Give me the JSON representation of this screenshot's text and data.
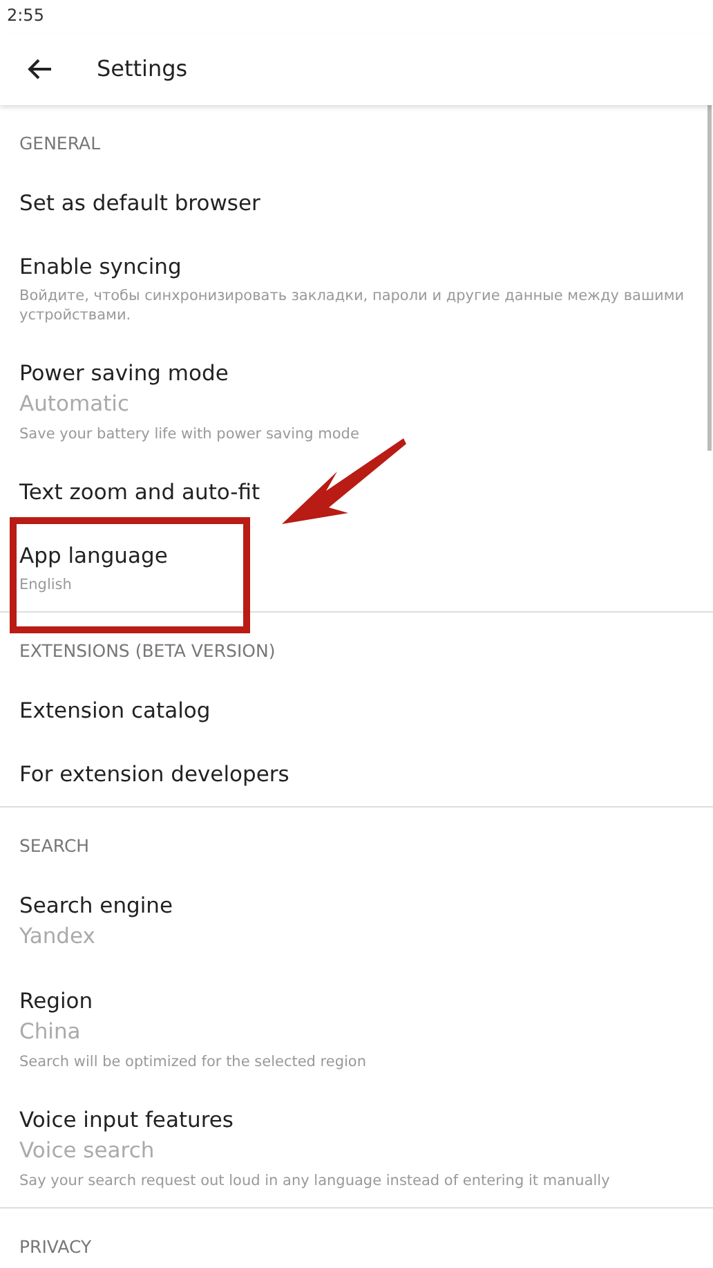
{
  "status_bar": {
    "time": "2:55"
  },
  "toolbar": {
    "title": "Settings"
  },
  "sections": [
    {
      "header": "GENERAL",
      "items": [
        {
          "title": "Set as default browser",
          "highlighted": false
        },
        {
          "title": "Enable syncing",
          "description": "Войдите, чтобы синхронизировать закладки, пароли и другие данные между вашими устройствами.",
          "highlighted": false
        },
        {
          "title": "Power saving mode",
          "value": "Automatic",
          "description": "Save your battery life with power saving mode",
          "highlighted": false
        },
        {
          "title": "Text zoom and auto-fit",
          "highlighted": false
        },
        {
          "title": "App language",
          "description": "English",
          "highlighted": true
        }
      ]
    },
    {
      "header": "EXTENSIONS (BETA VERSION)",
      "items": [
        {
          "title": "Extension catalog",
          "highlighted": false
        },
        {
          "title": "For extension developers",
          "highlighted": false
        }
      ]
    },
    {
      "header": "SEARCH",
      "items": [
        {
          "title": "Search engine",
          "value": "Yandex",
          "highlighted": false
        },
        {
          "title": "Region",
          "value": "China",
          "description": "Search will be optimized for the selected region",
          "highlighted": false
        },
        {
          "title": "Voice input features",
          "value": "Voice search",
          "description": "Say your search request out loud in any language instead of entering it manually",
          "highlighted": false
        }
      ]
    },
    {
      "header": "PRIVACY"
    }
  ]
}
